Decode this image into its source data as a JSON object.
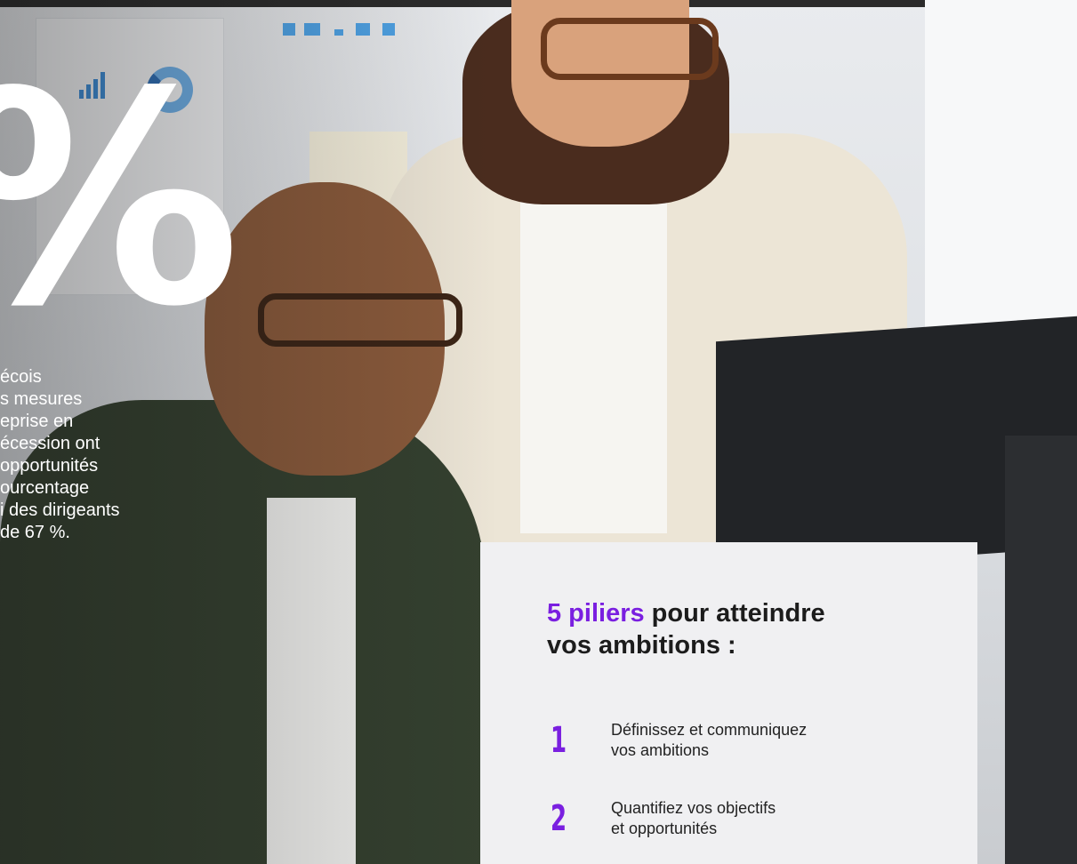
{
  "hero": {
    "big_symbol": "%",
    "stat_lines": [
      "écois",
      "s mesures",
      "eprise en",
      "écession ont",
      "opportunités",
      "ourcentage",
      "i des dirigeants",
      "de 67 %."
    ]
  },
  "card": {
    "title_highlight": "5 piliers",
    "title_rest": " pour atteindre",
    "title_line2": "vos ambitions :",
    "pillars": [
      {
        "number": "1",
        "line1": "Définissez et communiquez",
        "line2": "vos ambitions"
      },
      {
        "number": "2",
        "line1": "Quantifiez vos objectifs",
        "line2": "et opportunités"
      }
    ]
  },
  "colors": {
    "accent": "#7a1fe0",
    "card_bg": "#f0f0f2",
    "text": "#1c1c1c"
  }
}
